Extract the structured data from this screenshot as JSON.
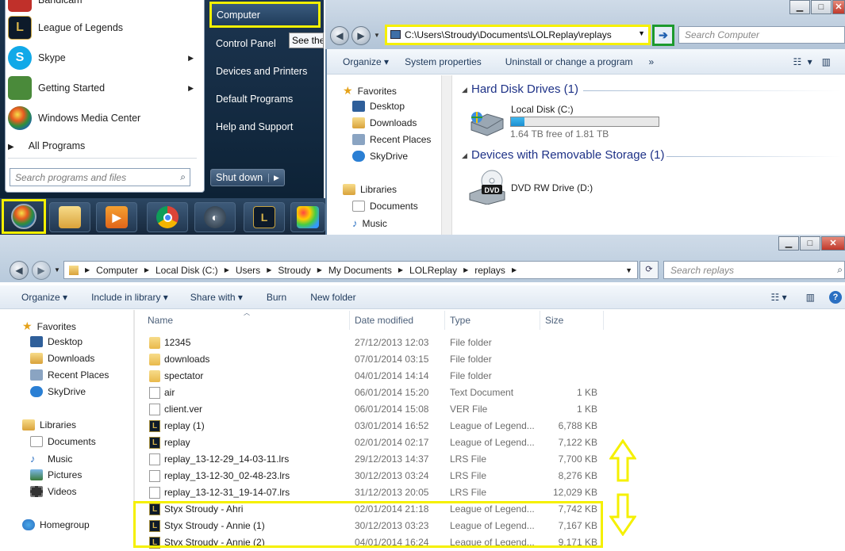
{
  "start_menu": {
    "programs": [
      {
        "label": "Bandicam",
        "icon": "bandicam-icon",
        "color": "#c0302a",
        "arrow": false
      },
      {
        "label": "League of Legends",
        "icon": "league-of-legends-icon",
        "color": "#0d1a2a",
        "arrow": false
      },
      {
        "label": "Skype",
        "icon": "skype-icon",
        "color": "#11a9e8",
        "arrow": true
      },
      {
        "label": "Getting Started",
        "icon": "getting-started-icon",
        "color": "#4a8a3a",
        "arrow": true
      },
      {
        "label": "Windows Media Center",
        "icon": "windows-media-center-icon",
        "color": "#2c8a3c",
        "arrow": false
      }
    ],
    "all_programs": "All Programs",
    "search_placeholder": "Search programs and files",
    "right_items": [
      "Computer",
      "Control Panel",
      "Devices and Printers",
      "Default Programs",
      "Help and Support"
    ],
    "tooltip": "See the",
    "shutdown": "Shut down"
  },
  "taskbar": {
    "apps": [
      "windows-explorer-icon",
      "media-player-icon",
      "chrome-icon",
      "steam-icon",
      "league-of-legends-icon",
      "paint-icon"
    ]
  },
  "explorer_top": {
    "address": "C:\\Users\\Stroudy\\Documents\\LOLReplay\\replays",
    "search_placeholder": "Search Computer",
    "toolbar": [
      "Organize ▾",
      "System properties",
      "Uninstall or change a program",
      "»"
    ],
    "favorites_label": "Favorites",
    "favorites": [
      "Desktop",
      "Downloads",
      "Recent Places",
      "SkyDrive"
    ],
    "libraries_label": "Libraries",
    "libraries": [
      "Documents",
      "Music"
    ],
    "group_hdd": "Hard Disk Drives (1)",
    "disk_name": "Local Disk (C:)",
    "disk_free": "1.64 TB free of 1.81 TB",
    "disk_used_fraction": 0.094,
    "group_removable": "Devices with Removable Storage (1)",
    "dvd_name": "DVD RW Drive (D:)"
  },
  "explorer_bottom": {
    "breadcrumb": [
      "Computer",
      "Local Disk (C:)",
      "Users",
      "Stroudy",
      "My Documents",
      "LOLReplay",
      "replays"
    ],
    "search_placeholder": "Search replays",
    "toolbar": [
      "Organize ▾",
      "Include in library ▾",
      "Share with ▾",
      "Burn",
      "New folder"
    ],
    "favorites_label": "Favorites",
    "favorites": [
      "Desktop",
      "Downloads",
      "Recent Places",
      "SkyDrive"
    ],
    "libraries_label": "Libraries",
    "libraries": [
      "Documents",
      "Music",
      "Pictures",
      "Videos"
    ],
    "homegroup": "Homegroup",
    "columns": [
      "Name",
      "Date modified",
      "Type",
      "Size"
    ],
    "files": [
      {
        "name": "12345",
        "date": "27/12/2013 12:03",
        "type": "File folder",
        "size": "",
        "kind": "folder"
      },
      {
        "name": "downloads",
        "date": "07/01/2014 03:15",
        "type": "File folder",
        "size": "",
        "kind": "folder"
      },
      {
        "name": "spectator",
        "date": "04/01/2014 14:14",
        "type": "File folder",
        "size": "",
        "kind": "folder"
      },
      {
        "name": "air",
        "date": "06/01/2014 15:20",
        "type": "Text Document",
        "size": "1 KB",
        "kind": "doc"
      },
      {
        "name": "client.ver",
        "date": "06/01/2014 15:08",
        "type": "VER File",
        "size": "1 KB",
        "kind": "doc"
      },
      {
        "name": "replay (1)",
        "date": "03/01/2014 16:52",
        "type": "League of Legend...",
        "size": "6,788 KB",
        "kind": "lol"
      },
      {
        "name": "replay",
        "date": "02/01/2014 02:17",
        "type": "League of Legend...",
        "size": "7,122 KB",
        "kind": "lol"
      },
      {
        "name": "replay_13-12-29_14-03-11.lrs",
        "date": "29/12/2013 14:37",
        "type": "LRS File",
        "size": "7,700 KB",
        "kind": "doc"
      },
      {
        "name": "replay_13-12-30_02-48-23.lrs",
        "date": "30/12/2013 03:24",
        "type": "LRS File",
        "size": "8,276 KB",
        "kind": "doc"
      },
      {
        "name": "replay_13-12-31_19-14-07.lrs",
        "date": "31/12/2013 20:05",
        "type": "LRS File",
        "size": "12,029 KB",
        "kind": "doc"
      },
      {
        "name": "Styx Stroudy - Ahri",
        "date": "02/01/2014 21:18",
        "type": "League of Legend...",
        "size": "7,742 KB",
        "kind": "lol"
      },
      {
        "name": "Styx Stroudy - Annie (1)",
        "date": "30/12/2013 03:23",
        "type": "League of Legend...",
        "size": "7,167 KB",
        "kind": "lol"
      },
      {
        "name": "Styx Stroudy - Annie (2)",
        "date": "04/01/2014 16:24",
        "type": "League of Legend...",
        "size": "9,171 KB",
        "kind": "lol"
      }
    ]
  },
  "colors": {
    "highlight": "#f5f000",
    "go_border": "#1c9a2d",
    "group_header": "#1e3287"
  }
}
